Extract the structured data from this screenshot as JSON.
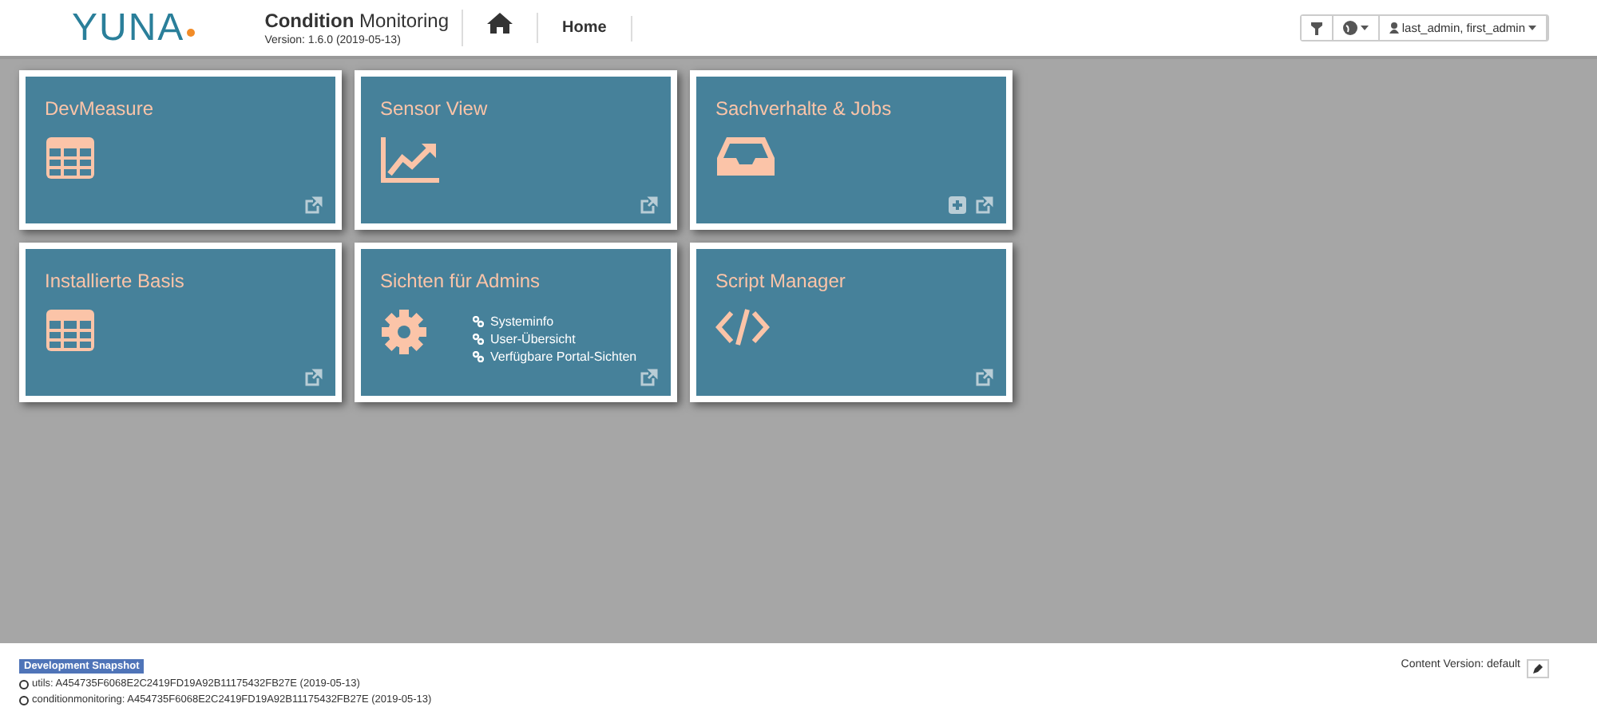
{
  "header": {
    "logo": "YUNA",
    "title": "**Condition** Monitoring",
    "version": "Version: 1.6.0 (2019-05-13)",
    "nav": [
      {
        "kind": "home"
      },
      {
        "kind": "text",
        "label": "Home"
      }
    ],
    "user": "last_admin, first_admin"
  },
  "tiles": [
    {
      "title": "DevMeasure",
      "kind": "table",
      "actions": [
        {
          "kind": "open"
        }
      ]
    },
    {
      "title": "Sensor View",
      "kind": "chart",
      "actions": [
        {
          "kind": "open"
        }
      ]
    },
    {
      "title": "Sachverhalte & Jobs",
      "kind": "inbox",
      "actions": [
        {
          "kind": "add"
        },
        {
          "kind": "open"
        }
      ]
    },
    {
      "title": "Installierte Basis",
      "kind": "table",
      "actions": [
        {
          "kind": "open"
        }
      ]
    },
    {
      "title": "Sichten für Admins",
      "kind": "gear",
      "links": [
        "Systeminfo",
        "User-Übersicht",
        "Verfügbare Portal-Sichten"
      ],
      "actions": [
        {
          "kind": "open"
        }
      ]
    },
    {
      "title": "Script Manager",
      "kind": "code",
      "actions": [
        {
          "kind": "open"
        }
      ]
    }
  ],
  "footer": {
    "badge": "Development Snapshot",
    "builds": [
      "utils: A454735F6068E2C2419FD19A92B11175432FB27E (2019-05-13)",
      "conditionmonitoring: A454735F6068E2C2419FD19A92B11175432FB27E (2019-05-13)"
    ],
    "content_version": "Content Version: default"
  }
}
